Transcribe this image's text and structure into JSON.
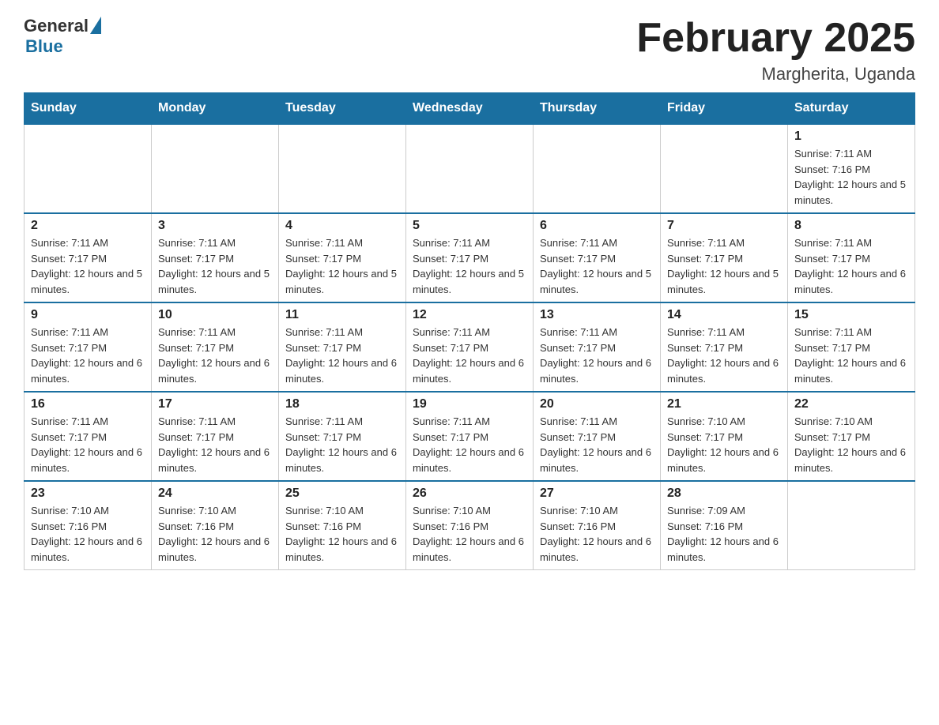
{
  "logo": {
    "general": "General",
    "blue": "Blue"
  },
  "title": {
    "month_year": "February 2025",
    "location": "Margherita, Uganda"
  },
  "days_of_week": [
    "Sunday",
    "Monday",
    "Tuesday",
    "Wednesday",
    "Thursday",
    "Friday",
    "Saturday"
  ],
  "weeks": [
    {
      "days": [
        {
          "num": "",
          "sunrise": "",
          "sunset": "",
          "daylight": ""
        },
        {
          "num": "",
          "sunrise": "",
          "sunset": "",
          "daylight": ""
        },
        {
          "num": "",
          "sunrise": "",
          "sunset": "",
          "daylight": ""
        },
        {
          "num": "",
          "sunrise": "",
          "sunset": "",
          "daylight": ""
        },
        {
          "num": "",
          "sunrise": "",
          "sunset": "",
          "daylight": ""
        },
        {
          "num": "",
          "sunrise": "",
          "sunset": "",
          "daylight": ""
        },
        {
          "num": "1",
          "sunrise": "Sunrise: 7:11 AM",
          "sunset": "Sunset: 7:16 PM",
          "daylight": "Daylight: 12 hours and 5 minutes."
        }
      ]
    },
    {
      "days": [
        {
          "num": "2",
          "sunrise": "Sunrise: 7:11 AM",
          "sunset": "Sunset: 7:17 PM",
          "daylight": "Daylight: 12 hours and 5 minutes."
        },
        {
          "num": "3",
          "sunrise": "Sunrise: 7:11 AM",
          "sunset": "Sunset: 7:17 PM",
          "daylight": "Daylight: 12 hours and 5 minutes."
        },
        {
          "num": "4",
          "sunrise": "Sunrise: 7:11 AM",
          "sunset": "Sunset: 7:17 PM",
          "daylight": "Daylight: 12 hours and 5 minutes."
        },
        {
          "num": "5",
          "sunrise": "Sunrise: 7:11 AM",
          "sunset": "Sunset: 7:17 PM",
          "daylight": "Daylight: 12 hours and 5 minutes."
        },
        {
          "num": "6",
          "sunrise": "Sunrise: 7:11 AM",
          "sunset": "Sunset: 7:17 PM",
          "daylight": "Daylight: 12 hours and 5 minutes."
        },
        {
          "num": "7",
          "sunrise": "Sunrise: 7:11 AM",
          "sunset": "Sunset: 7:17 PM",
          "daylight": "Daylight: 12 hours and 5 minutes."
        },
        {
          "num": "8",
          "sunrise": "Sunrise: 7:11 AM",
          "sunset": "Sunset: 7:17 PM",
          "daylight": "Daylight: 12 hours and 6 minutes."
        }
      ]
    },
    {
      "days": [
        {
          "num": "9",
          "sunrise": "Sunrise: 7:11 AM",
          "sunset": "Sunset: 7:17 PM",
          "daylight": "Daylight: 12 hours and 6 minutes."
        },
        {
          "num": "10",
          "sunrise": "Sunrise: 7:11 AM",
          "sunset": "Sunset: 7:17 PM",
          "daylight": "Daylight: 12 hours and 6 minutes."
        },
        {
          "num": "11",
          "sunrise": "Sunrise: 7:11 AM",
          "sunset": "Sunset: 7:17 PM",
          "daylight": "Daylight: 12 hours and 6 minutes."
        },
        {
          "num": "12",
          "sunrise": "Sunrise: 7:11 AM",
          "sunset": "Sunset: 7:17 PM",
          "daylight": "Daylight: 12 hours and 6 minutes."
        },
        {
          "num": "13",
          "sunrise": "Sunrise: 7:11 AM",
          "sunset": "Sunset: 7:17 PM",
          "daylight": "Daylight: 12 hours and 6 minutes."
        },
        {
          "num": "14",
          "sunrise": "Sunrise: 7:11 AM",
          "sunset": "Sunset: 7:17 PM",
          "daylight": "Daylight: 12 hours and 6 minutes."
        },
        {
          "num": "15",
          "sunrise": "Sunrise: 7:11 AM",
          "sunset": "Sunset: 7:17 PM",
          "daylight": "Daylight: 12 hours and 6 minutes."
        }
      ]
    },
    {
      "days": [
        {
          "num": "16",
          "sunrise": "Sunrise: 7:11 AM",
          "sunset": "Sunset: 7:17 PM",
          "daylight": "Daylight: 12 hours and 6 minutes."
        },
        {
          "num": "17",
          "sunrise": "Sunrise: 7:11 AM",
          "sunset": "Sunset: 7:17 PM",
          "daylight": "Daylight: 12 hours and 6 minutes."
        },
        {
          "num": "18",
          "sunrise": "Sunrise: 7:11 AM",
          "sunset": "Sunset: 7:17 PM",
          "daylight": "Daylight: 12 hours and 6 minutes."
        },
        {
          "num": "19",
          "sunrise": "Sunrise: 7:11 AM",
          "sunset": "Sunset: 7:17 PM",
          "daylight": "Daylight: 12 hours and 6 minutes."
        },
        {
          "num": "20",
          "sunrise": "Sunrise: 7:11 AM",
          "sunset": "Sunset: 7:17 PM",
          "daylight": "Daylight: 12 hours and 6 minutes."
        },
        {
          "num": "21",
          "sunrise": "Sunrise: 7:10 AM",
          "sunset": "Sunset: 7:17 PM",
          "daylight": "Daylight: 12 hours and 6 minutes."
        },
        {
          "num": "22",
          "sunrise": "Sunrise: 7:10 AM",
          "sunset": "Sunset: 7:17 PM",
          "daylight": "Daylight: 12 hours and 6 minutes."
        }
      ]
    },
    {
      "days": [
        {
          "num": "23",
          "sunrise": "Sunrise: 7:10 AM",
          "sunset": "Sunset: 7:16 PM",
          "daylight": "Daylight: 12 hours and 6 minutes."
        },
        {
          "num": "24",
          "sunrise": "Sunrise: 7:10 AM",
          "sunset": "Sunset: 7:16 PM",
          "daylight": "Daylight: 12 hours and 6 minutes."
        },
        {
          "num": "25",
          "sunrise": "Sunrise: 7:10 AM",
          "sunset": "Sunset: 7:16 PM",
          "daylight": "Daylight: 12 hours and 6 minutes."
        },
        {
          "num": "26",
          "sunrise": "Sunrise: 7:10 AM",
          "sunset": "Sunset: 7:16 PM",
          "daylight": "Daylight: 12 hours and 6 minutes."
        },
        {
          "num": "27",
          "sunrise": "Sunrise: 7:10 AM",
          "sunset": "Sunset: 7:16 PM",
          "daylight": "Daylight: 12 hours and 6 minutes."
        },
        {
          "num": "28",
          "sunrise": "Sunrise: 7:09 AM",
          "sunset": "Sunset: 7:16 PM",
          "daylight": "Daylight: 12 hours and 6 minutes."
        },
        {
          "num": "",
          "sunrise": "",
          "sunset": "",
          "daylight": ""
        }
      ]
    }
  ]
}
